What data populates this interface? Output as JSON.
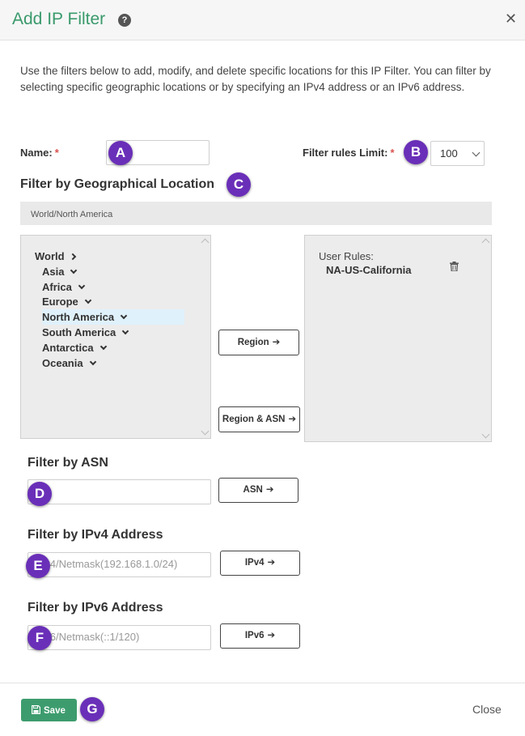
{
  "header": {
    "title": "Add IP Filter",
    "help_glyph": "?",
    "close_glyph": "✕"
  },
  "intro": "Use the filters below to add, modify, and delete specific locations for this IP Filter. You can filter by selecting specific geographic locations or by specifying an IPv4 address or an IPv6 address.",
  "form": {
    "name_label": "Name:",
    "required_mark": "*",
    "limit_label": "Filter rules Limit:",
    "limit_value": "100"
  },
  "geo": {
    "heading": "Filter by Geographical Location",
    "breadcrumb": "World/North America",
    "tree": [
      {
        "label": "World",
        "expand": "right"
      },
      {
        "label": "Asia",
        "expand": "down"
      },
      {
        "label": "Africa",
        "expand": "down"
      },
      {
        "label": "Europe",
        "expand": "down"
      },
      {
        "label": "North America",
        "expand": "down",
        "selected": true
      },
      {
        "label": "South America",
        "expand": "down"
      },
      {
        "label": "Antarctica",
        "expand": "down"
      },
      {
        "label": "Oceania",
        "expand": "down"
      }
    ],
    "region_btn": "Region",
    "region_asn_btn": "Region & ASN",
    "user_rules_label": "User Rules:",
    "user_rules": [
      "NA-US-California"
    ]
  },
  "asn": {
    "heading": "Filter by ASN",
    "button": "ASN"
  },
  "ipv4": {
    "heading": "Filter by IPv4 Address",
    "placeholder": "IPv4/Netmask(192.168.1.0/24)",
    "button": "IPv4"
  },
  "ipv6": {
    "heading": "Filter by IPv6 Address",
    "placeholder": "IPv6/Netmask(::1/120)",
    "button": "IPv6"
  },
  "footer": {
    "save": "Save",
    "close": "Close"
  },
  "markers": {
    "a": "A",
    "b": "B",
    "c": "C",
    "d": "D",
    "e": "E",
    "f": "F",
    "g": "G"
  },
  "glyphs": {
    "arrow": "➔"
  },
  "colors": {
    "accent": "#3a9a6c",
    "save_bg": "#3d9c6e",
    "marker": "#6a2fb8",
    "required": "#d9534f"
  }
}
